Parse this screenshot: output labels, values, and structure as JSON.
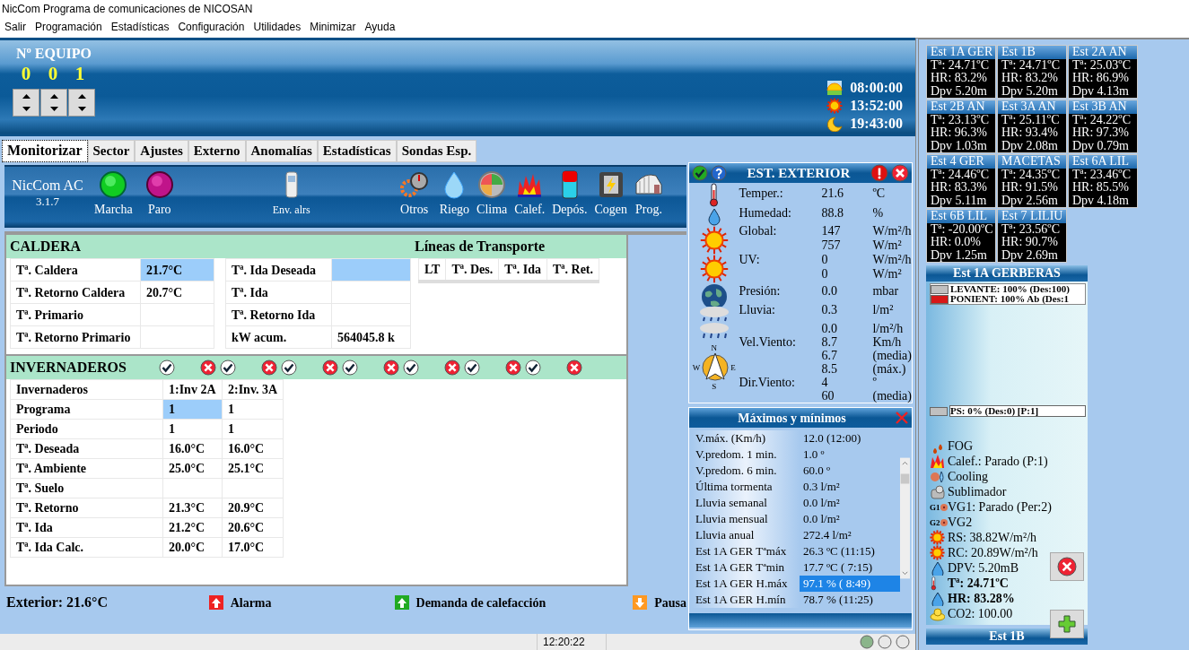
{
  "window": {
    "title": "NicCom  Programa de comunicaciones de NICOSAN"
  },
  "menu": [
    "Salir",
    "Programación",
    "Estadísticas",
    "Configuración",
    "Utilidades",
    "Minimizar",
    "Ayuda"
  ],
  "equipo": {
    "label": "Nº EQUIPO",
    "digits": [
      "0",
      "0",
      "1"
    ]
  },
  "sun_times": [
    {
      "kind": "sunrise",
      "time": "08:00:00"
    },
    {
      "kind": "noon",
      "time": "13:52:00"
    },
    {
      "kind": "sunset",
      "time": "19:43:00"
    }
  ],
  "tabs": [
    {
      "label": "Monitorizar",
      "selected": true
    },
    {
      "label": "Sector",
      "selected": false
    },
    {
      "label": "Ajustes",
      "selected": false
    },
    {
      "label": "Externo",
      "selected": false
    },
    {
      "label": "Anomalías",
      "selected": false
    },
    {
      "label": "Estadísticas",
      "selected": false
    },
    {
      "label": "Sondas Esp.",
      "selected": false
    }
  ],
  "toolbar": {
    "app_name": "NicCom AC",
    "version": "3.1.7",
    "buttons": [
      {
        "kind": "marcha",
        "label": "Marcha"
      },
      {
        "kind": "paro",
        "label": "Paro"
      },
      {
        "kind": "phone",
        "label": "Env. alrs"
      },
      {
        "kind": "otros",
        "label": "Otros"
      },
      {
        "kind": "riego",
        "label": "Riego"
      },
      {
        "kind": "clima",
        "label": "Clima"
      },
      {
        "kind": "calef",
        "label": "Calef."
      },
      {
        "kind": "depos",
        "label": "Depós."
      },
      {
        "kind": "cogen",
        "label": "Cogen"
      },
      {
        "kind": "prog",
        "label": "Prog."
      }
    ]
  },
  "caldera": {
    "title": "CALDERA",
    "rows": [
      {
        "label": "Tª. Caldera",
        "value": "21.7°C",
        "selected": true
      },
      {
        "label": "Tª. Retorno Caldera",
        "value": "20.7°C",
        "selected": false
      },
      {
        "label": "Tª. Primario",
        "selected": false
      },
      {
        "label": "Tª. Retorno Primario",
        "selected": false
      }
    ],
    "rows_right": [
      {
        "label": "Tª. Ida Deseada",
        "selected": true
      },
      {
        "label": "Tª. Ida",
        "selected": false
      },
      {
        "label": "Tª. Retorno Ida",
        "selected": false
      },
      {
        "label": "kW acum.",
        "value": "564045.8 k",
        "selected": false
      }
    ],
    "transport": {
      "title": "Líneas de Transporte",
      "columns": [
        "LT",
        "Tª. Des.",
        "Tª. Ida",
        "Tª. Ret."
      ]
    }
  },
  "invernaderos": {
    "title": "INVERNADEROS",
    "toggles": [
      {
        "kind": "ok"
      },
      {
        "kind": "cancel"
      },
      {
        "kind": "ok"
      },
      {
        "kind": "cancel"
      },
      {
        "kind": "ok"
      },
      {
        "kind": "cancel"
      },
      {
        "kind": "ok"
      },
      {
        "kind": "cancel"
      },
      {
        "kind": "ok"
      },
      {
        "kind": "cancel"
      },
      {
        "kind": "ok"
      },
      {
        "kind": "cancel"
      },
      {
        "kind": "ok"
      },
      {
        "kind": "cancel"
      }
    ],
    "columns": [
      "Invernaderos",
      "1:Inv 2A",
      "2:Inv. 3A"
    ],
    "rows": [
      {
        "label": "Programa",
        "values": [
          {
            "text": "1",
            "selected": true
          },
          {
            "text": "1",
            "selected": false
          }
        ]
      },
      {
        "label": "Periodo",
        "values": [
          {
            "text": "1",
            "selected": false
          },
          {
            "text": "1",
            "selected": false
          }
        ]
      },
      {
        "label": "Tª. Deseada",
        "values": [
          {
            "text": "16.0°C",
            "selected": false
          },
          {
            "text": "16.0°C",
            "selected": false
          }
        ]
      },
      {
        "label": "Tª. Ambiente",
        "values": [
          {
            "text": "25.0°C",
            "selected": false
          },
          {
            "text": "25.1°C",
            "selected": false
          }
        ]
      },
      {
        "label": "Tª. Suelo",
        "values": [
          {
            "selected": false
          },
          {
            "selected": false
          }
        ]
      },
      {
        "label": "Tª. Retorno",
        "values": [
          {
            "text": "21.3°C",
            "selected": false
          },
          {
            "text": "20.9°C",
            "selected": false
          }
        ]
      },
      {
        "label": "Tª. Ida",
        "values": [
          {
            "text": "21.2°C",
            "selected": false
          },
          {
            "text": "20.6°C",
            "selected": false
          }
        ]
      },
      {
        "label": "Tª. Ida Calc.",
        "values": [
          {
            "text": "20.0°C",
            "selected": false
          },
          {
            "text": "17.0°C",
            "selected": false
          }
        ]
      }
    ]
  },
  "footer": {
    "exterior": "Exterior: 21.6°C",
    "legends": [
      {
        "kind": "alarm",
        "label": "Alarma"
      },
      {
        "kind": "demand",
        "label": "Demanda de calefacción"
      },
      {
        "kind": "pause",
        "label": "Pausa"
      }
    ]
  },
  "exterior": {
    "title": "EST. EXTERIOR",
    "compass": [
      "N",
      "W",
      "E",
      "S"
    ],
    "rows": [
      {
        "label": "Temper.:",
        "value": "21.6",
        "unit": "ºC"
      },
      {
        "label": "Humedad:",
        "value": "88.8",
        "unit": "%"
      },
      {
        "label": "Global:",
        "value": "147",
        "unit": "W/m²/h"
      },
      {
        "value": "757",
        "unit": "W/m²"
      },
      {
        "label": "UV:",
        "value": "0",
        "unit": "W/m²/h"
      },
      {
        "value": "0",
        "unit": "W/m²"
      },
      {
        "label": "Presión:",
        "value": "0.0",
        "unit": "mbar"
      },
      {
        "label": "Lluvia:",
        "value": "0.3",
        "unit": "l/m²"
      },
      {
        "value": "0.0",
        "unit": "l/m²/h"
      },
      {
        "label": "Vel.Viento:",
        "value": "8.7",
        "unit": "Km/h"
      },
      {
        "value": "6.7",
        "unit": "(media)"
      },
      {
        "value": "8.5",
        "unit": "(máx.)"
      },
      {
        "label": "Dir.Viento:",
        "value": "4",
        "unit": "º"
      },
      {
        "value": "60",
        "unit": "(media)"
      }
    ]
  },
  "maxmin": {
    "title": "Máximos y mínimos",
    "rows": [
      {
        "label": "V.máx. (Km/h)",
        "value": "12.0  (12:00)",
        "selected": false
      },
      {
        "label": "V.predom. 1 min.",
        "value": "1.0 º",
        "selected": false
      },
      {
        "label": "V.predom. 6 min.",
        "value": "60.0 º",
        "selected": false
      },
      {
        "label": "Última tormenta",
        "value": "0.3 l/m²",
        "selected": false
      },
      {
        "label": "Lluvia semanal",
        "value": "0.0 l/m²",
        "selected": false
      },
      {
        "label": "Lluvia mensual",
        "value": "0.0 l/m²",
        "selected": false
      },
      {
        "label": "Lluvia anual",
        "value": "272.4 l/m²",
        "selected": false
      },
      {
        "label": "Est 1A GER Tªmáx",
        "value": "26.3 ºC (11:15)",
        "selected": false
      },
      {
        "label": "Est 1A GER Tªmin",
        "value": "17.7 ºC ( 7:15)",
        "selected": false
      },
      {
        "label": "Est 1A GER H.máx",
        "value": "97.1 % ( 8:49)",
        "selected": true
      },
      {
        "label": "Est 1A GER H.mín",
        "value": "78.7 % (11:25)",
        "selected": false
      }
    ]
  },
  "stations": [
    {
      "name": "Est 1A GER",
      "t": "Tª: 24.71ºC",
      "hr": "HR: 83.2%",
      "dpv": "Dpv 5.20m"
    },
    {
      "name": "Est 1B",
      "t": "Tª: 24.71ºC",
      "hr": "HR: 83.2%",
      "dpv": "Dpv 5.20m"
    },
    {
      "name": "Est 2A AN",
      "t": "Tª: 25.03ºC",
      "hr": "HR: 86.9%",
      "dpv": "Dpv 4.13m"
    },
    {
      "name": "Est 2B AN",
      "t": "Tª: 23.13ºC",
      "hr": "HR: 96.3%",
      "dpv": "Dpv 1.03m"
    },
    {
      "name": "Est 3A AN",
      "t": "Tª: 25.11ºC",
      "hr": "HR: 93.4%",
      "dpv": "Dpv 2.08m"
    },
    {
      "name": "Est 3B AN",
      "t": "Tª: 24.22ºC",
      "hr": "HR: 97.3%",
      "dpv": "Dpv 0.79m"
    },
    {
      "name": "Est 4 GER",
      "t": "Tª: 24.46ºC",
      "hr": "HR: 83.3%",
      "dpv": "Dpv 5.11m"
    },
    {
      "name": "MACETAS",
      "t": "Tª: 24.35ºC",
      "hr": "HR: 91.5%",
      "dpv": "Dpv 2.56m"
    },
    {
      "name": "Est 6A LIL",
      "t": "Tª: 23.46ºC",
      "hr": "HR: 85.5%",
      "dpv": "Dpv 4.18m"
    },
    {
      "name": "Est 6B LIL",
      "t": "Tª: -20.00ºC",
      "hr": "HR: 0.0%",
      "dpv": "Dpv 1.25m"
    },
    {
      "name": "Est 7 LILIU",
      "t": "Tª: 23.56ºC",
      "hr": "HR: 90.7%",
      "dpv": "Dpv 2.69m"
    }
  ],
  "detail": {
    "title": "Est 1A GERBERAS",
    "outputs": [
      {
        "label": "LEVANTE: 100% (Des:100)",
        "color": "#c0c0c0"
      },
      {
        "label": "PONIENT: 100% Ab (Des:1",
        "color": "#d81818"
      }
    ],
    "ps": {
      "label": "PS: 0% (Des:0) [P:1]",
      "color": "#c0c0c0"
    },
    "items": [
      {
        "kind": "fog",
        "text": "FOG",
        "bold": false
      },
      {
        "kind": "flame",
        "text": "Calef.: Parado (P:1)",
        "bold": false
      },
      {
        "kind": "cooling",
        "text": "Cooling",
        "bold": false
      },
      {
        "kind": "sublimador",
        "text": "Sublimador",
        "bold": false
      },
      {
        "kind": "fan",
        "badge": "G1",
        "text": "VG1: Parado (Per:2)",
        "bold": false
      },
      {
        "kind": "fan",
        "badge": "G2",
        "text": "VG2",
        "bold": false
      },
      {
        "kind": "sun",
        "text": "RS: 38.82W/m²/h",
        "bold": false
      },
      {
        "kind": "sun",
        "text": "RC: 20.89W/m²/h",
        "bold": false
      },
      {
        "kind": "drop",
        "text": "DPV: 5.20mB",
        "bold": false
      },
      {
        "kind": "thermo",
        "text": "Tª: 24.71ºC",
        "bold": true
      },
      {
        "kind": "drop",
        "text": "HR: 83.28%",
        "bold": true
      },
      {
        "kind": "co2",
        "text": "CO2: 100.00",
        "bold": false
      }
    ],
    "next_title": "Est 1B"
  },
  "status": {
    "time": "12:20:22",
    "leds": [
      {
        "on": true
      },
      {
        "on": false
      },
      {
        "on": false
      }
    ]
  }
}
